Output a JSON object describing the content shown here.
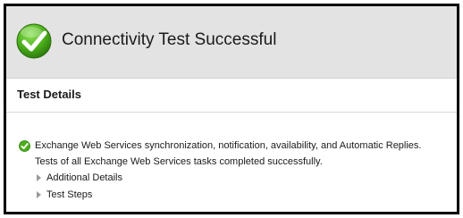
{
  "header": {
    "title": "Connectivity Test Successful",
    "icon": "success-check-icon",
    "background": "#e3e3e3"
  },
  "details": {
    "title": "Test Details"
  },
  "result": {
    "icon": "success-check-icon",
    "message": "Exchange Web Services synchronization, notification, availability, and Automatic Replies.",
    "summary": "Tests of all Exchange Web Services tasks completed successfully.",
    "expanders": [
      {
        "label": "Additional Details",
        "icon": "triangle-right-icon"
      },
      {
        "label": "Test Steps",
        "icon": "triangle-right-icon"
      }
    ]
  },
  "colors": {
    "success_green": "#4caf1a",
    "text": "#1a1a1a"
  }
}
